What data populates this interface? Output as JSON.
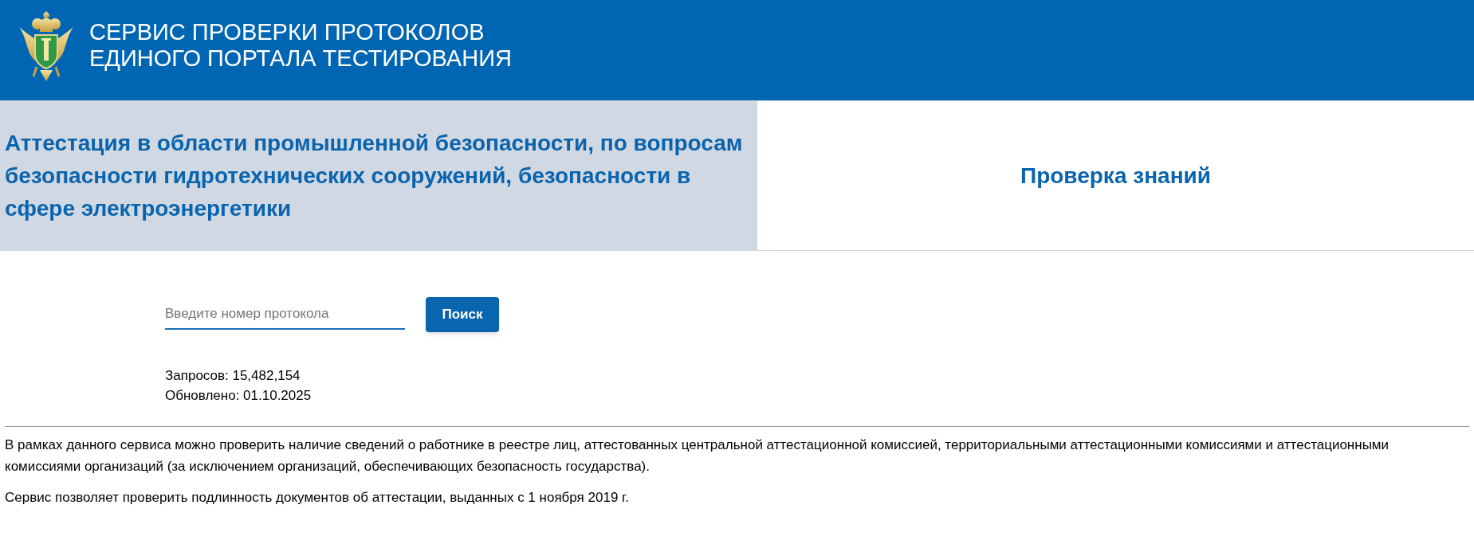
{
  "header": {
    "title_lines": [
      "СЕРВИС ПРОВЕРКИ ПРОТОКОЛОВ",
      "ЕДИНОГО ПОРТАЛА ТЕСТИРОВАНИЯ"
    ]
  },
  "tabs": [
    {
      "label": "Аттестация в области промышленной безопасности, по вопросам безопасности гидротехнических сооружений, безопасности в сфере электроэнергетики",
      "selected": true
    },
    {
      "label": "Проверка знаний",
      "selected": false
    }
  ],
  "search": {
    "placeholder": "Введите номер протокола",
    "button": "Поиск"
  },
  "stats": [
    "Запросов: 15,482,154",
    "Обновлено: 01.10.2025"
  ],
  "info": [
    "В рамках данного сервиса можно проверить наличие сведений о работнике в реестре лиц, аттестованных центральной аттестационной комиссией, территориальными аттестационными комиссиями и аттестационными комиссиями организаций (за исключением организаций, обеспечивающих безопасность государства).",
    "Сервис позволяет проверить подлинность документов об аттестации, выданных с 1 ноября 2019 г."
  ]
}
